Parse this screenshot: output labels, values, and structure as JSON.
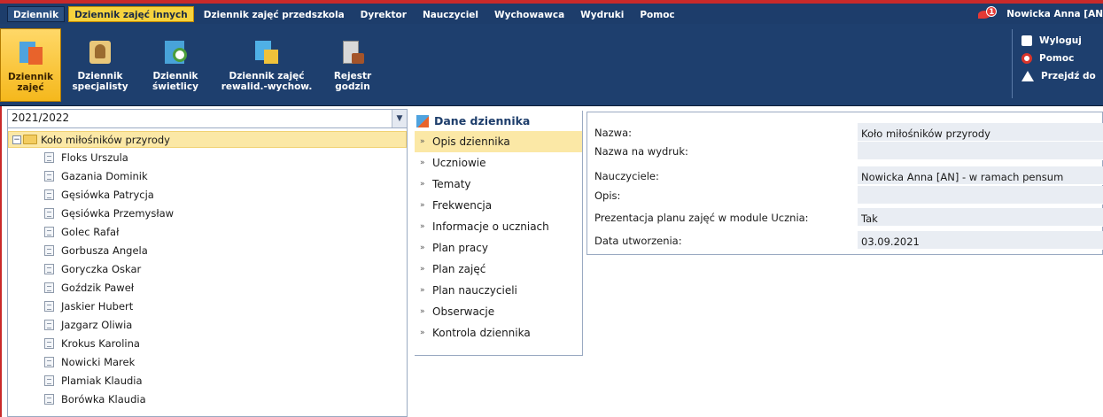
{
  "menu": {
    "items": [
      {
        "label": "Dziennik"
      },
      {
        "label": "Dziennik zajęć innych"
      },
      {
        "label": "Dziennik zajęć przedszkola"
      },
      {
        "label": "Dyrektor"
      },
      {
        "label": "Nauczyciel"
      },
      {
        "label": "Wychowawca"
      },
      {
        "label": "Wydruki"
      },
      {
        "label": "Pomoc"
      }
    ],
    "notification_count": "1",
    "user": "Nowicka Anna [AN"
  },
  "ribbon": {
    "tools": [
      {
        "label_line1": "Dziennik",
        "label_line2": "zajęć",
        "icon": "journal-icon"
      },
      {
        "label_line1": "Dziennik",
        "label_line2": "specjalisty",
        "icon": "specialist-icon"
      },
      {
        "label_line1": "Dziennik",
        "label_line2": "świetlicy",
        "icon": "common-room-icon"
      },
      {
        "label_line1": "Dziennik zajęć",
        "label_line2": "rewalid.-wychow.",
        "icon": "revalidation-icon"
      },
      {
        "label_line1": "Rejestr",
        "label_line2": "godzin",
        "icon": "hours-register-icon"
      }
    ],
    "side_links": {
      "logout": "Wyloguj",
      "help": "Pomoc",
      "goto": "Przejdź do"
    }
  },
  "left_panel": {
    "school_year": "2021/2022",
    "tree_root": "Koło miłośników przyrody",
    "students": [
      "Floks Urszula",
      "Gazania Dominik",
      "Gęsiówka Patrycja",
      "Gęsiówka Przemysław",
      "Golec Rafał",
      "Gorbusza Angela",
      "Goryczka Oskar",
      "Goździk Paweł",
      "Jaskier Hubert",
      "Jazgarz Oliwia",
      "Krokus Karolina",
      "Nowicki Marek",
      "Plamiak Klaudia",
      "Borówka Klaudia"
    ]
  },
  "nav": {
    "header": "Dane dziennika",
    "items": [
      "Opis dziennika",
      "Uczniowie",
      "Tematy",
      "Frekwencja",
      "Informacje o uczniach",
      "Plan pracy",
      "Plan zajęć",
      "Plan nauczycieli",
      "Obserwacje",
      "Kontrola dziennika"
    ],
    "active_index": 0
  },
  "details": {
    "rows": [
      {
        "key": "Nazwa:",
        "value": "Koło miłośników przyrody"
      },
      {
        "key": "Nazwa na wydruk:",
        "value": ""
      },
      {
        "key": "Nauczyciele:",
        "value": "Nowicka Anna [AN] - w ramach pensum"
      },
      {
        "key": "Opis:",
        "value": ""
      },
      {
        "key": "Prezentacja planu zajęć w module Ucznia:",
        "value": "Tak"
      },
      {
        "key": "Data utworzenia:",
        "value": "03.09.2021"
      }
    ]
  },
  "colors": {
    "menubar": "#1d3d6b",
    "accent_yellow": "#f6d33e",
    "alert_red": "#c92a2a",
    "selection": "#fbe8a6"
  }
}
